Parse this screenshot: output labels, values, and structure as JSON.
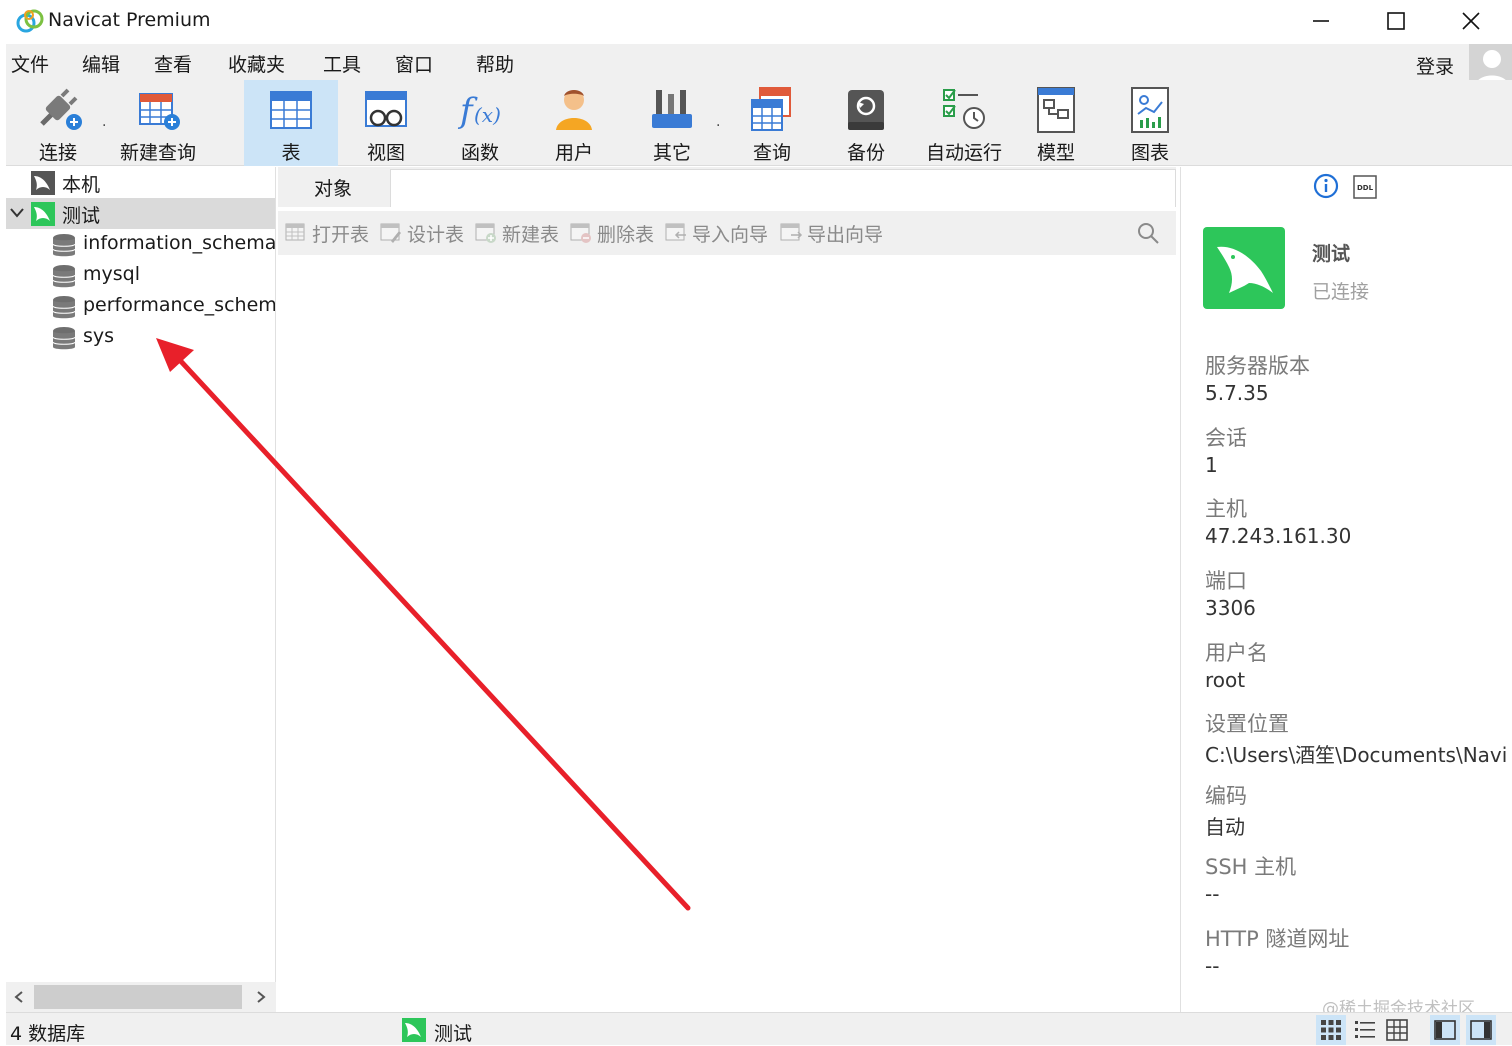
{
  "app": {
    "title": "Navicat Premium"
  },
  "menu": [
    "文件",
    "编辑",
    "查看",
    "收藏夹",
    "工具",
    "窗口",
    "帮助"
  ],
  "login": "登录",
  "toolbar": {
    "connect": "连接",
    "new_query": "新建查询",
    "table": "表",
    "view": "视图",
    "function": "函数",
    "user": "用户",
    "other": "其它",
    "query": "查询",
    "backup": "备份",
    "auto_run": "自动运行",
    "model": "模型",
    "chart": "图表"
  },
  "tree": {
    "local": "本机",
    "test_conn": "测试",
    "databases": [
      "information_schema",
      "mysql",
      "performance_schema",
      "sys"
    ]
  },
  "tabs": {
    "objects": "对象"
  },
  "object_toolbar": {
    "open_table": "打开表",
    "design_table": "设计表",
    "new_table": "新建表",
    "delete_table": "删除表",
    "import_wizard": "导入向导",
    "export_wizard": "导出向导"
  },
  "info": {
    "ddl": "DDL",
    "name": "测试",
    "status": "已连接",
    "props": [
      {
        "label": "服务器版本",
        "value": "5.7.35"
      },
      {
        "label": "会话",
        "value": "1"
      },
      {
        "label": "主机",
        "value": "47.243.161.30"
      },
      {
        "label": "端口",
        "value": "3306"
      },
      {
        "label": "用户名",
        "value": "root"
      },
      {
        "label": "设置位置",
        "value": "C:\\Users\\酒笙\\Documents\\Navi"
      },
      {
        "label": "编码",
        "value": "自动"
      },
      {
        "label": "SSH 主机",
        "value": "--"
      },
      {
        "label": "HTTP 隧道网址",
        "value": "--"
      }
    ]
  },
  "status": {
    "count": "4 数据库",
    "connection": "测试"
  },
  "watermark": "@稀土掘金技术社区",
  "colors": {
    "accent": "#1f6fd6",
    "connected_green": "#2dc65a",
    "arrow": "#e8202a",
    "selected_bg": "#cce4f7"
  }
}
